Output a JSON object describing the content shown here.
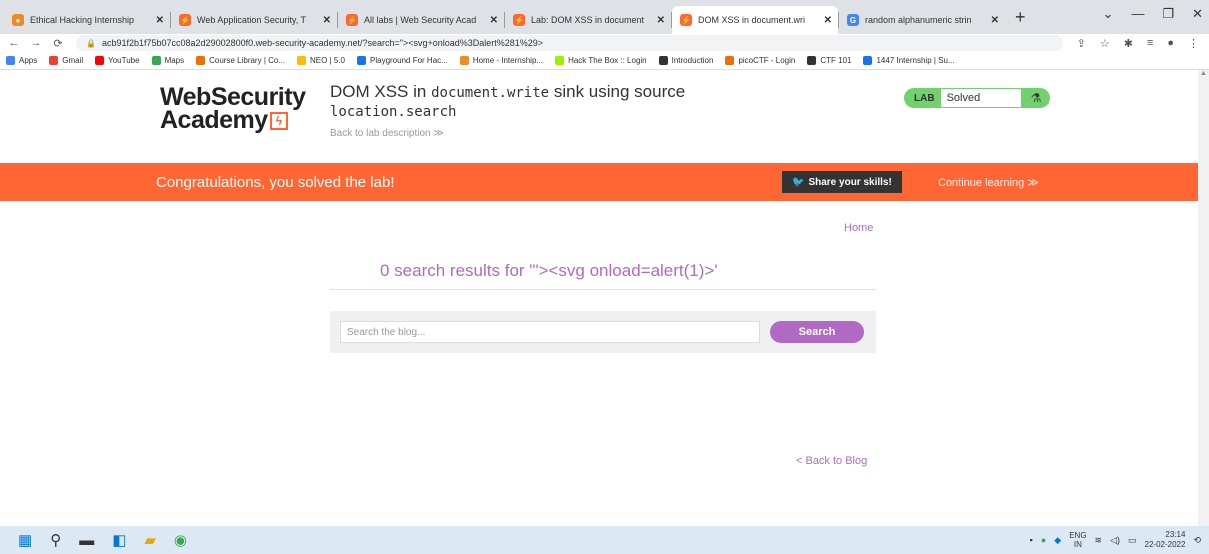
{
  "browser": {
    "tabs": [
      {
        "title": "Ethical Hacking Internship",
        "fav_color": "#f08a24",
        "fav_glyph": "●",
        "active": false
      },
      {
        "title": "Web Application Security, T",
        "fav_color": "#ff6633",
        "fav_glyph": "⚡",
        "active": false
      },
      {
        "title": "All labs | Web Security Acad",
        "fav_color": "#ff6633",
        "fav_glyph": "⚡",
        "active": false
      },
      {
        "title": "Lab: DOM XSS in document",
        "fav_color": "#ff6633",
        "fav_glyph": "⚡",
        "active": false
      },
      {
        "title": "DOM XSS in document.wri",
        "fav_color": "#ff6633",
        "fav_glyph": "⚡",
        "active": true
      },
      {
        "title": "random alphanumeric strin",
        "fav_color": "#4285f4",
        "fav_glyph": "G",
        "active": false
      }
    ],
    "url": "acb91f2b1f75b07cc08a2d29002800f0.web-security-academy.net/?search=\"><svg+onload%3Dalert%281%29>",
    "bookmarks": [
      {
        "label": "Apps",
        "color": "#4285f4"
      },
      {
        "label": "Gmail",
        "color": "#ea4335"
      },
      {
        "label": "YouTube",
        "color": "#ff0000"
      },
      {
        "label": "Maps",
        "color": "#34a853"
      },
      {
        "label": "Course Library | Co...",
        "color": "#e8710a"
      },
      {
        "label": "NEO | 5.0",
        "color": "#fbbc04"
      },
      {
        "label": "Playground For Hac...",
        "color": "#1a73e8"
      },
      {
        "label": "Home - Internship...",
        "color": "#f08a24"
      },
      {
        "label": "Hack The Box :: Login",
        "color": "#9fef00"
      },
      {
        "label": "Introduction",
        "color": "#333333"
      },
      {
        "label": "picoCTF - Login",
        "color": "#e8710a"
      },
      {
        "label": "CTF 101",
        "color": "#333333"
      },
      {
        "label": "1447 Internship | Su...",
        "color": "#1a73e8"
      }
    ]
  },
  "header": {
    "logo_line1": "WebSecurity",
    "logo_line2": "Academy",
    "lab_title_prefix": "DOM XSS in",
    "lab_title_code": "document.write",
    "lab_title_mid": "sink using source",
    "lab_title_code2": "location.search",
    "back_to_description": "Back to lab description ≫",
    "lab_label": "LAB",
    "lab_status": "Solved"
  },
  "banner": {
    "message": "Congratulations, you solved the lab!",
    "share_label": "Share your skills!",
    "continue_label": "Continue learning ≫"
  },
  "main": {
    "home_link": "Home",
    "results_text": "0 search results for '\"><svg onload=alert(1)>'",
    "search_placeholder": "Search the blog...",
    "search_button": "Search",
    "back_to_blog": "< Back to Blog"
  },
  "taskbar": {
    "lang_top": "ENG",
    "lang_bottom": "IN",
    "time": "23:14",
    "date": "22-02-2022"
  }
}
